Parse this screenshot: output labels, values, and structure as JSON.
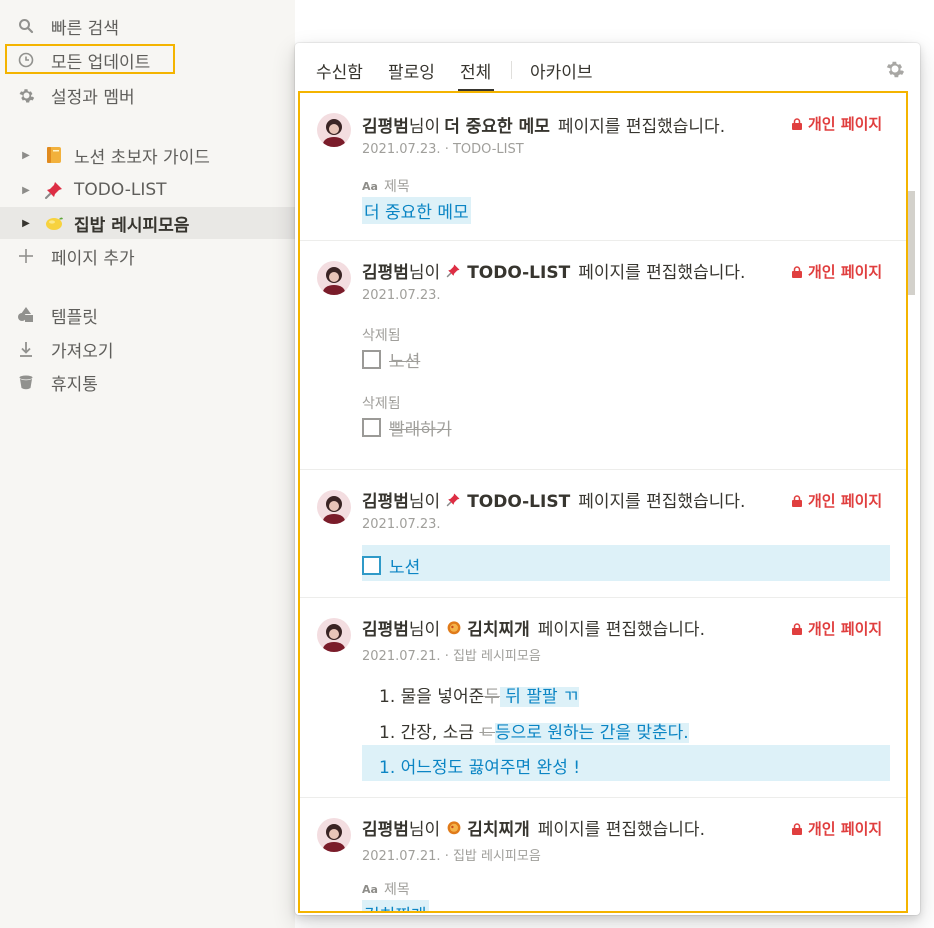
{
  "sidebar": {
    "top_items": [
      {
        "label": "빠른 검색",
        "icon": "search-icon"
      },
      {
        "label": "모든 업데이트",
        "icon": "clock-icon"
      },
      {
        "label": "설정과 멤버",
        "icon": "gear-icon"
      }
    ],
    "pages": [
      {
        "label": "노션 초보자 가이드",
        "icon": "notebook-emoji-icon"
      },
      {
        "label": "TODO-LIST",
        "icon": "pushpin-emoji-icon"
      },
      {
        "label": "집밥 레시피모음",
        "icon": "lemon-emoji-icon"
      }
    ],
    "add_page": "페이지 추가",
    "bottom_items": [
      {
        "label": "템플릿",
        "icon": "template-icon"
      },
      {
        "label": "가져오기",
        "icon": "import-icon"
      },
      {
        "label": "휴지통",
        "icon": "trash-icon"
      }
    ]
  },
  "panel": {
    "tabs": [
      "수신함",
      "팔로잉",
      "전체",
      "아카이브"
    ],
    "active_tab": "전체"
  },
  "updates": [
    {
      "user": "김평범",
      "user_suffix": "님이",
      "page": "더 중요한 메모",
      "action": "페이지를 편집했습니다.",
      "badge": "개인 페이지",
      "meta": "2021.07.23. · TODO-LIST",
      "prop_label": "제목",
      "prop_icon_text": "Aa",
      "added_text": "더 중요한 메모"
    },
    {
      "user": "김평범",
      "user_suffix": "님이",
      "page": "TODO-LIST",
      "action": "페이지를 편집했습니다.",
      "badge": "개인 페이지",
      "meta": "2021.07.23.",
      "deleted_label_1": "삭제됨",
      "deleted_item_1": "노션",
      "deleted_label_2": "삭제됨",
      "deleted_item_2": "빨래하기"
    },
    {
      "user": "김평범",
      "user_suffix": "님이",
      "page": "TODO-LIST",
      "action": "페이지를 편집했습니다.",
      "badge": "개인 페이지",
      "meta": "2021.07.23.",
      "added_todo": "노션"
    },
    {
      "user": "김평범",
      "user_suffix": "님이",
      "page": "김치찌개",
      "action": "페이지를 편집했습니다.",
      "badge": "개인 페이지",
      "meta": "2021.07.21. · 집밥 레시피모음",
      "line1_prefix": "1. 물을 넣어준",
      "line1_removed": "두",
      "line1_added": " 뒤 팔팔 ㄲ",
      "line2_prefix": "1. 간장, 소금 ",
      "line2_removed": "ㄷ",
      "line2_added": "등으로 원하는 간을 맞춘다.",
      "line3_added": "1. 어느정도 끓여주면 완성 !"
    },
    {
      "user": "김평범",
      "user_suffix": "님이",
      "page": "김치찌개",
      "action": "페이지를 편집했습니다.",
      "badge": "개인 페이지",
      "meta": "2021.07.21. · 집밥 레시피모음",
      "prop_label": "제목",
      "prop_icon_text": "Aa",
      "added_text": "김치찌개"
    }
  ],
  "colors": {
    "accent_blue": "#0b85c4",
    "added_bg": "#ddf1f8",
    "private_red": "#e03e3e",
    "highlight": "#f4b400"
  }
}
